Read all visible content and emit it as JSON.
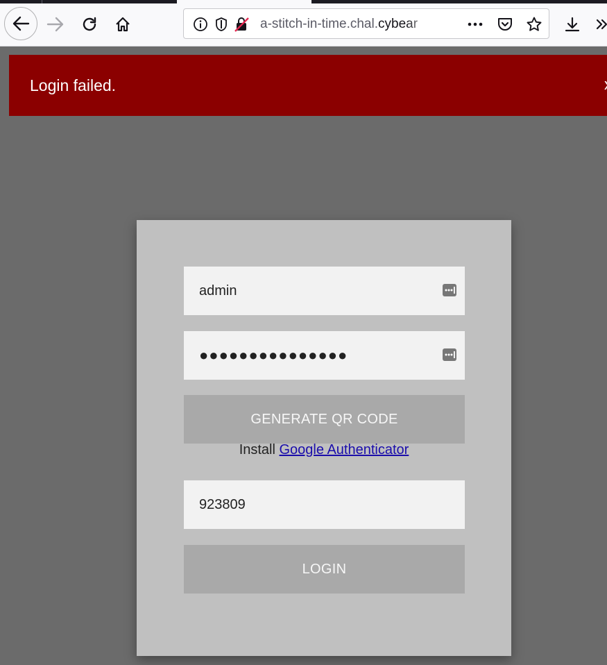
{
  "browser": {
    "url_prefix": "a-stitch-in-time.chal.",
    "url_domain": "cybear",
    "icons": {
      "back": "back-arrow-icon",
      "forward": "forward-arrow-icon",
      "reload": "reload-icon",
      "home": "home-icon",
      "site_info": "info-icon",
      "tracking_protection": "shield-icon",
      "insecure": "insecure-lock-icon",
      "page_actions": "ellipsis-icon",
      "pocket": "pocket-icon",
      "bookmark": "star-icon",
      "downloads": "download-icon",
      "overflow": "chevron-overflow-icon"
    }
  },
  "alert": {
    "message": "Login failed.",
    "close": "x",
    "color": "#8b0000"
  },
  "form": {
    "username": "admin",
    "password_mask": "●●●●●●●●●●●●●●●",
    "generate_label": "GENERATE QR CODE",
    "install_prefix": "Install ",
    "install_link": "Google Authenticator",
    "otp": "923809",
    "login_label": "LOGIN"
  },
  "colors": {
    "page_bg": "#6b6b6b",
    "card_bg": "#c0c0c0",
    "button_bg": "#a9a9a9",
    "link": "#1a0dab"
  }
}
